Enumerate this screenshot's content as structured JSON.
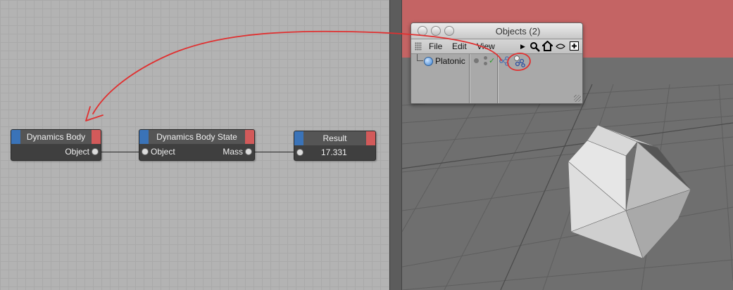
{
  "node_editor": {
    "nodes": {
      "dynamics_body": {
        "title": "Dynamics Body",
        "port_out": "Object"
      },
      "dynamics_body_state": {
        "title": "Dynamics Body State",
        "port_in": "Object",
        "port_out": "Mass"
      },
      "result": {
        "title": "Result",
        "value": "17.331"
      }
    }
  },
  "objects_window": {
    "title": "Objects (2)",
    "menu": {
      "file": "File",
      "edit": "Edit",
      "view": "View"
    },
    "toolbar_icons": [
      "play-arrow-icon",
      "search-icon",
      "home-icon",
      "eye-icon",
      "add-icon"
    ],
    "objects": [
      {
        "name": "Platonic"
      }
    ]
  },
  "colors": {
    "input_cap": "#3a73b8",
    "output_cap": "#d35a5a",
    "viewport_header": "#c46464",
    "annotation": "#e03030"
  }
}
